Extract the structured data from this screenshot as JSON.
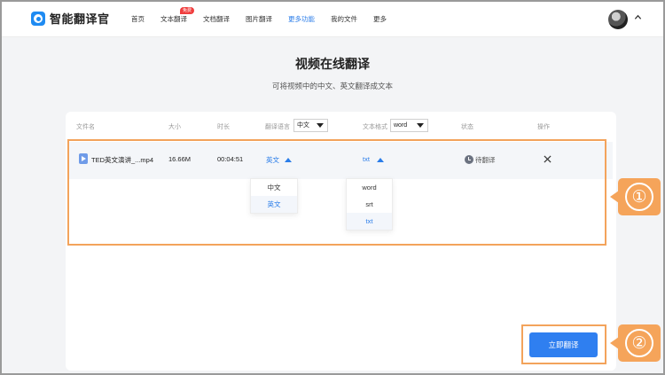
{
  "header": {
    "brand": "智能翻译官",
    "nav": [
      {
        "label": "首页"
      },
      {
        "label": "文本翻译",
        "badge": "免费"
      },
      {
        "label": "文档翻译"
      },
      {
        "label": "图片翻译"
      },
      {
        "label": "更多功能",
        "active": true
      },
      {
        "label": "我的文件"
      },
      {
        "label": "更多"
      }
    ]
  },
  "page": {
    "title": "视频在线翻译",
    "subtitle": "可将视频中的中文、英文翻译成文本"
  },
  "table": {
    "columns": {
      "filename": "文件名",
      "size": "大小",
      "duration": "时长",
      "language": "翻译语言",
      "format": "文本格式",
      "status": "状态",
      "action": "操作"
    },
    "header_language_select": "中文",
    "header_format_select": "word",
    "row": {
      "filename": "TED英文演讲_...mp4",
      "size": "16.66M",
      "duration": "00:04:51",
      "language": "英文",
      "format": "txt",
      "status": "待翻译"
    },
    "language_options": [
      "中文",
      "英文"
    ],
    "language_selected": "英文",
    "format_options": [
      "word",
      "srt",
      "txt"
    ],
    "format_selected": "txt"
  },
  "translate_button": "立即翻译",
  "annotations": [
    "①",
    "②"
  ],
  "colors": {
    "accent": "#2f7ff0",
    "annotation": "#f3a35b"
  }
}
